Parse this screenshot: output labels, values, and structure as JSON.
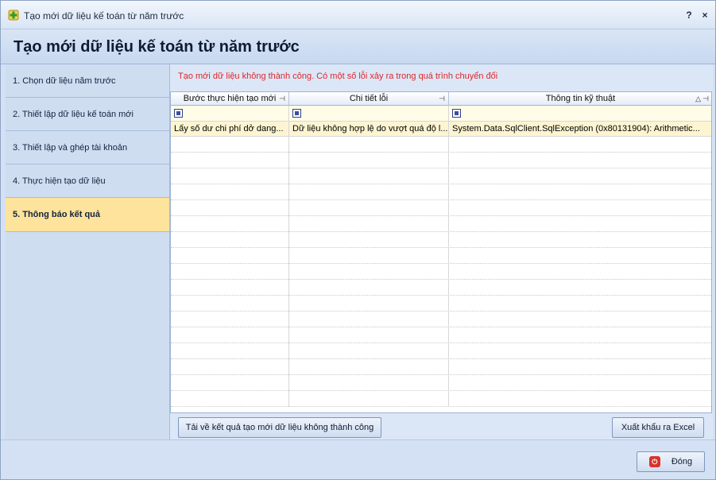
{
  "window": {
    "title": "Tạo mới dữ liệu kế toán từ năm trước",
    "help_label": "?",
    "close_label": "×"
  },
  "header": {
    "title": "Tạo mới dữ liệu kế toán từ năm trước"
  },
  "sidebar": {
    "steps": [
      {
        "label": "1. Chọn dữ liệu năm trước"
      },
      {
        "label": "2. Thiết lập dữ liệu kế toán mới"
      },
      {
        "label": "3. Thiết lập và ghép tài khoản"
      },
      {
        "label": "4. Thực hiện tạo dữ liệu"
      },
      {
        "label": "5. Thông báo kết quả",
        "active": true
      }
    ]
  },
  "main": {
    "error_message": "Tạo mới dữ liệu không thành công. Có một số lỗi xảy ra trong quá trình chuyển đổi",
    "grid": {
      "columns": [
        "Bước thực hiện tạo mới",
        "Chi tiết lỗi",
        "Thông tin kỹ thuật"
      ],
      "rows": [
        [
          "Lấy số dư chi phí dở dang...",
          "Dữ liệu không hợp lệ do vượt quá độ l...",
          "System.Data.SqlClient.SqlException (0x80131904): Arithmetic..."
        ]
      ]
    },
    "download_button": "Tải về kết quả tạo mới dữ liệu không thành công",
    "export_button": "Xuất khẩu ra Excel"
  },
  "footer": {
    "close_button": "Đóng"
  },
  "colors": {
    "error_text": "#e0252b",
    "active_step": "#fde39b",
    "row_highlight": "#fdf5d2"
  },
  "icons": {
    "app": "green-plus-icon",
    "pin": "pin-icon",
    "filter": "filter-checkbox-icon",
    "close": "close-red-icon"
  }
}
